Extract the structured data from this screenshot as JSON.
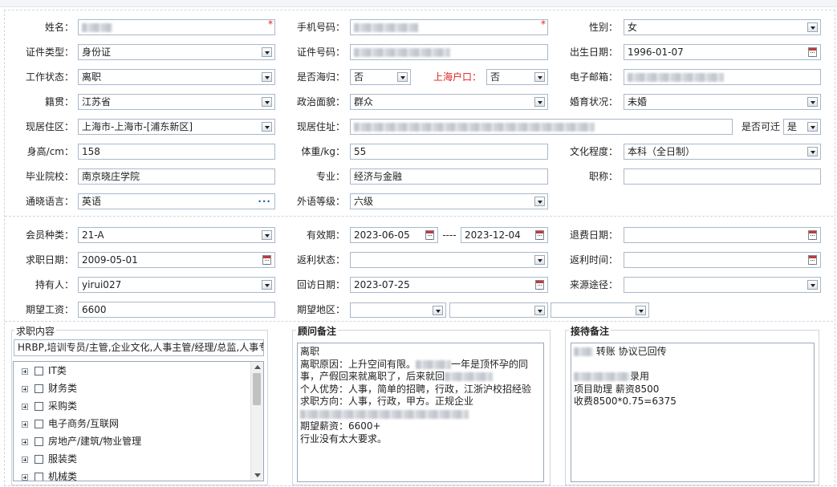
{
  "labels": {
    "name": "姓名：",
    "phone": "手机号码：",
    "gender": "性别：",
    "id_type": "证件类型：",
    "id_no": "证件号码：",
    "birth": "出生日期：",
    "work_status": "工作状态：",
    "returnee": "是否海归：",
    "sh_hukou": "上海户口：",
    "email": "电子邮箱：",
    "native": "籍贯：",
    "political": "政治面貌：",
    "marital": "婚育状况：",
    "residence_area": "现居住区：",
    "residence_addr": "现居住址：",
    "relocate": "是否可迁",
    "height": "身高/cm：",
    "weight": "体重/kg：",
    "education": "文化程度：",
    "school": "毕业院校：",
    "major": "专业：",
    "title": "职称：",
    "language": "通晓语言：",
    "foreign_level": "外语等级：",
    "member_type": "会员种类：",
    "validity": "有效期：",
    "refund_date": "退费日期：",
    "job_date": "求职日期：",
    "rebate_status": "返利状态：",
    "rebate_time": "返利时间：",
    "holder": "持有人：",
    "visit_date": "回访日期：",
    "source": "来源途径：",
    "expected_salary": "期望工资：",
    "expected_region": "期望地区："
  },
  "values": {
    "gender": "女",
    "id_type": "身份证",
    "birth": "1996-01-07",
    "work_status": "离职",
    "returnee": "否",
    "sh_hukou": "否",
    "native": "江苏省",
    "political": "群众",
    "marital": "未婚",
    "residence_area": "上海市-上海市-[浦东新区]",
    "relocate": "是",
    "height": "158",
    "weight": "55",
    "education": "本科（全日制）",
    "school": "南京晓庄学院",
    "major": "经济与金融",
    "title": "",
    "language": "英语",
    "foreign_level": "六级",
    "member_type": "21-A",
    "validity_start": "2023-06-05",
    "validity_sep": "----",
    "validity_end": "2023-12-04",
    "refund_date": "",
    "job_date": "2009-05-01",
    "rebate_status": "",
    "rebate_time": "",
    "holder": "yirui027",
    "visit_date": "2023-07-25",
    "source": "",
    "expected_salary": "6600"
  },
  "job_content": {
    "title": "求职内容",
    "summary": "HRBP,培训专员/主管,企业文化,人事主管/经理/总监,人事专",
    "categories": [
      "IT类",
      "财务类",
      "采购类",
      "电子商务/互联网",
      "房地产/建筑/物业管理",
      "服装类",
      "机械类"
    ]
  },
  "consultant_notes": {
    "title": "顾问备注",
    "lines": [
      "离职",
      "离职原因：上升空间有限。",
      "一年是顶怀孕的同",
      "事，产假回来就离职了，后来就回",
      "个人优势：人事，简单的招聘，行政，江浙沪校招经验",
      "求职方向：人事，行政，甲方。正规企业",
      "期望薪资：6600+",
      "行业没有太大要求。"
    ]
  },
  "reception_notes": {
    "title": "接待备注",
    "lines": [
      "转账 协议已回传",
      "录用",
      "项目助理 薪资8500",
      "收费8500*0.75=6375"
    ]
  },
  "required_mark": "*"
}
